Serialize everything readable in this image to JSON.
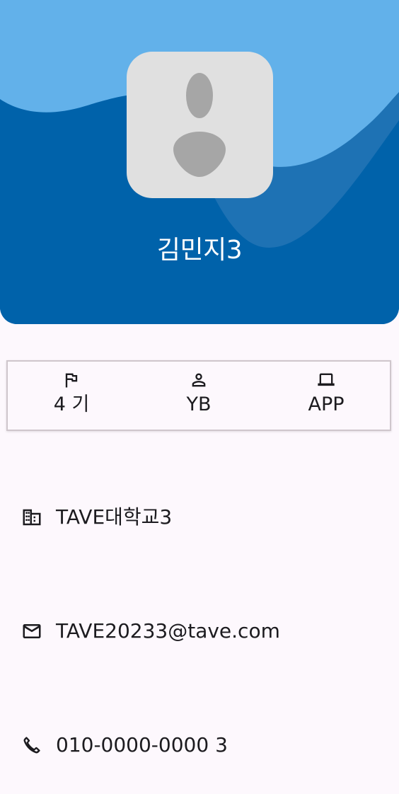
{
  "profile": {
    "name": "김민지3",
    "avatar_icon": "person-placeholder-icon"
  },
  "info_card": {
    "items": [
      {
        "icon": "flag-icon",
        "label": "4 기"
      },
      {
        "icon": "person-icon",
        "label": "YB"
      },
      {
        "icon": "laptop-icon",
        "label": "APP"
      }
    ]
  },
  "details": {
    "school": {
      "icon": "building-icon",
      "text": "TAVE대학교3"
    },
    "email": {
      "icon": "mail-icon",
      "text": "TAVE20233@tave.com"
    },
    "phone": {
      "icon": "phone-icon",
      "text": "010-0000-0000 3"
    }
  },
  "colors": {
    "header_dark": "#0062aa",
    "header_mid": "#1e72b4",
    "header_light": "#62b1ea",
    "background": "#fdf8fd"
  }
}
